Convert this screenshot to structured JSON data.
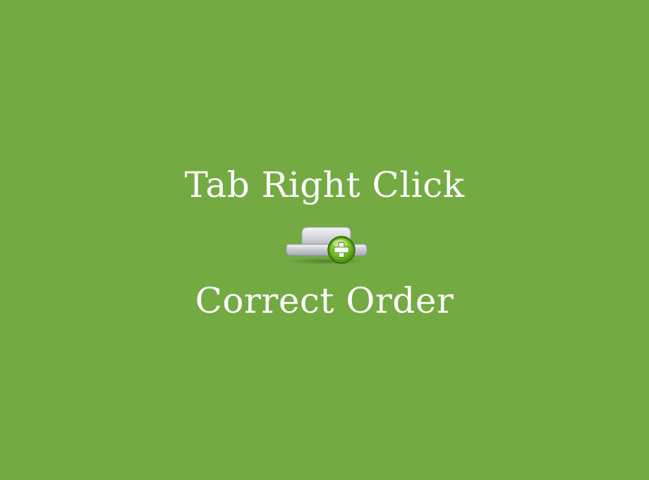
{
  "banner": {
    "title_line_1": "Tab Right Click",
    "title_line_2": "Correct Order",
    "background_color": "#73aa42",
    "text_color": "#ffffff",
    "icon": "new-tab-plus-icon"
  }
}
